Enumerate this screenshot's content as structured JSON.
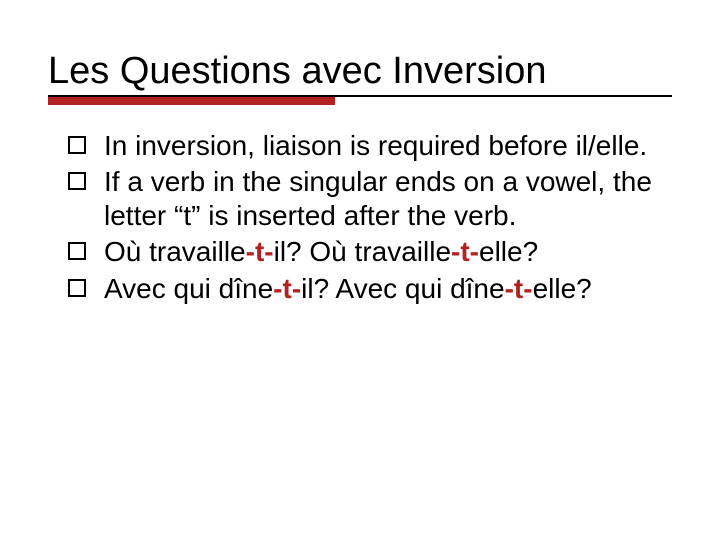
{
  "title": "Les Questions avec Inversion",
  "accent_color": "#b22222",
  "bullets": [
    {
      "segments": [
        {
          "text": "In inversion, liaison is required before il/elle."
        }
      ]
    },
    {
      "segments": [
        {
          "text": "If a verb in the singular ends on a vowel, the letter “t” is inserted after the verb."
        }
      ]
    },
    {
      "segments": [
        {
          "text": "Où travaille"
        },
        {
          "text": "-t-",
          "highlight": true
        },
        {
          "text": "il?  Où travaille"
        },
        {
          "text": "-t-",
          "highlight": true
        },
        {
          "text": "elle?"
        }
      ]
    },
    {
      "segments": [
        {
          "text": "Avec qui dîne"
        },
        {
          "text": "-t-",
          "highlight": true
        },
        {
          "text": "il?  Avec qui dîne"
        },
        {
          "text": "-t-",
          "highlight": true
        },
        {
          "text": "elle?"
        }
      ]
    }
  ]
}
